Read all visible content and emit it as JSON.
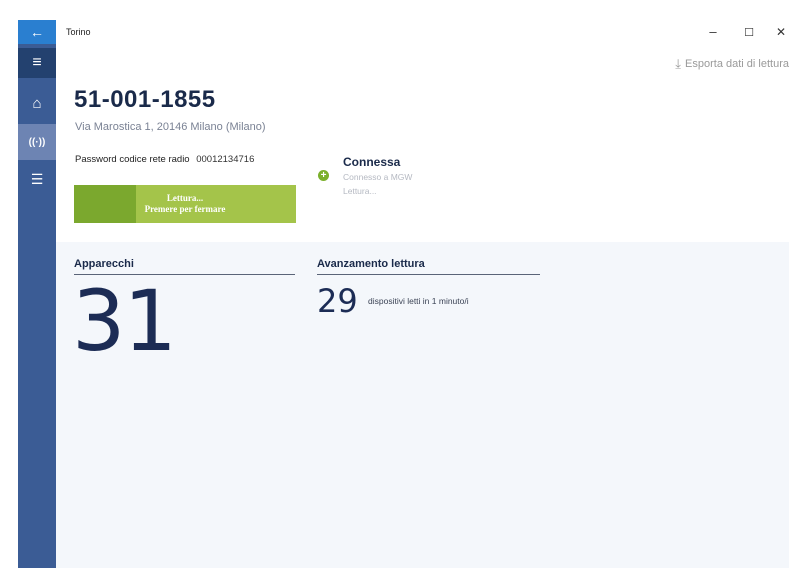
{
  "window": {
    "title": "Torino",
    "minimize": "–",
    "maximize": "☐",
    "close": "✕"
  },
  "nav": {
    "back_icon": "←",
    "menu_icon": "≡",
    "home_icon": "⌂",
    "radio_icon": "((·))",
    "list_icon": "☰"
  },
  "toolbar": {
    "export_label": "Esporta dati di lettura",
    "export_icon": "⤓"
  },
  "meter": {
    "id": "51-001-1855",
    "address": "Via Marostica 1, 20146 Milano (Milano)",
    "password_label": "Password codice rete radio",
    "password_value": "00012134716"
  },
  "read_button": {
    "line1": "Lettura...",
    "line2": "Premere per fermare"
  },
  "connection": {
    "status": "Connessa",
    "icon": "+",
    "detail1": "Connesso a MGW",
    "detail2": "Lettura..."
  },
  "devices": {
    "title": "Apparecchi",
    "count": "31"
  },
  "progress": {
    "title": "Avanzamento lettura",
    "count": "29",
    "text": "dispositivi letti in 1 minuto/i"
  },
  "colors": {
    "rail": "#3b5c95",
    "accent_blue": "#2a7fd0",
    "read_green": "#a4c44a",
    "read_green_dark": "#7ba82e",
    "status_green": "#7bb02c"
  }
}
